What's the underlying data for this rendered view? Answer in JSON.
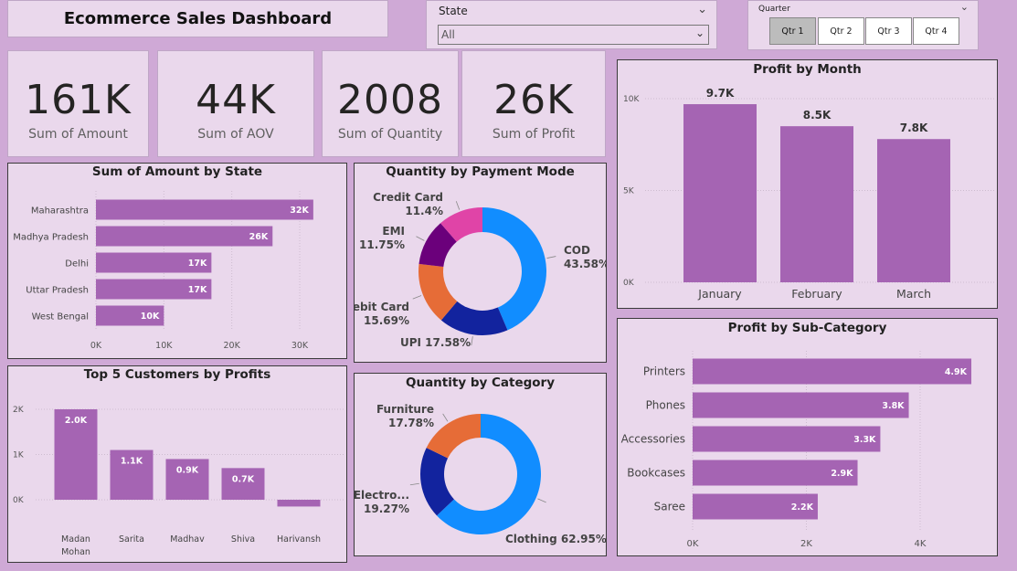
{
  "dashboard": {
    "title": "Ecommerce Sales Dashboard"
  },
  "state_slicer": {
    "label": "State",
    "value": "All"
  },
  "quarter_slicer": {
    "label": "Quarter",
    "options": [
      "Qtr 1",
      "Qtr 2",
      "Qtr 3",
      "Qtr 4"
    ],
    "selected": "Qtr 1"
  },
  "kpis": [
    {
      "value": "161K",
      "label": "Sum of Amount"
    },
    {
      "value": "44K",
      "label": "Sum of AOV"
    },
    {
      "value": "2008",
      "label": "Sum of Quantity"
    },
    {
      "value": "26K",
      "label": "Sum of Profit"
    }
  ],
  "colors": {
    "bar": "#a564b3",
    "bg": "#ead8ec",
    "page": "#cfa9d6"
  },
  "chart_data": [
    {
      "id": "amount_by_state",
      "type": "bar",
      "orientation": "horizontal",
      "title": "Sum of Amount by State",
      "categories": [
        "Maharashtra",
        "Madhya Pradesh",
        "Delhi",
        "Uttar Pradesh",
        "West Bengal"
      ],
      "values": [
        32,
        26,
        17,
        17,
        10
      ],
      "data_labels": [
        "32K",
        "26K",
        "17K",
        "17K",
        "10K"
      ],
      "xticks": [
        "0K",
        "10K",
        "20K",
        "30K"
      ],
      "xlim": [
        0,
        30
      ],
      "color": "#a564b3"
    },
    {
      "id": "payment_mode",
      "type": "pie",
      "title": "Quantity by Payment Mode",
      "slices": [
        {
          "name": "COD",
          "value": 43.58,
          "label": "43.58%",
          "color": "#118dff"
        },
        {
          "name": "UPI",
          "value": 17.58,
          "label": "17.58%",
          "color": "#12239e"
        },
        {
          "name": "Debit Card",
          "value": 15.69,
          "label": "15.69%",
          "color": "#e66c37"
        },
        {
          "name": "EMI",
          "value": 11.75,
          "label": "11.75%",
          "color": "#6b007b"
        },
        {
          "name": "Credit Card",
          "value": 11.4,
          "label": "11.4%",
          "color": "#e044a7"
        }
      ]
    },
    {
      "id": "profit_by_month",
      "type": "bar",
      "title": "Profit by Month",
      "categories": [
        "January",
        "February",
        "March"
      ],
      "values": [
        9.7,
        8.5,
        7.8
      ],
      "data_labels": [
        "9.7K",
        "8.5K",
        "7.8K"
      ],
      "yticks": [
        "0K",
        "5K",
        "10K"
      ],
      "ylim": [
        0,
        10
      ],
      "color": "#a564b3"
    },
    {
      "id": "top_customers",
      "type": "bar",
      "title": "Top 5 Customers by Profits",
      "categories": [
        "Madan Mohan",
        "Sarita",
        "Madhav",
        "Shiva",
        "Harivansh"
      ],
      "values": [
        2.0,
        1.1,
        0.9,
        0.7,
        -0.15
      ],
      "data_labels": [
        "2.0K",
        "1.1K",
        "0.9K",
        "0.7K",
        ""
      ],
      "yticks": [
        "0K",
        "1K",
        "2K"
      ],
      "ylim": [
        0,
        2
      ],
      "color": "#a564b3"
    },
    {
      "id": "category",
      "type": "pie",
      "title": "Quantity by Category",
      "slices": [
        {
          "name": "Clothing",
          "value": 62.95,
          "label": "62.95%",
          "color": "#118dff"
        },
        {
          "name": "Electro...",
          "value": 19.27,
          "label": "19.27%",
          "color": "#12239e"
        },
        {
          "name": "Furniture",
          "value": 17.78,
          "label": "17.78%",
          "color": "#e66c37"
        }
      ]
    },
    {
      "id": "profit_by_subcategory",
      "type": "bar",
      "orientation": "horizontal",
      "title": "Profit by Sub-Category",
      "categories": [
        "Printers",
        "Phones",
        "Accessories",
        "Bookcases",
        "Saree"
      ],
      "values": [
        4.9,
        3.8,
        3.3,
        2.9,
        2.2
      ],
      "data_labels": [
        "4.9K",
        "3.8K",
        "3.3K",
        "2.9K",
        "2.2K"
      ],
      "xticks": [
        "0K",
        "2K",
        "4K"
      ],
      "xlim": [
        0,
        4
      ],
      "color": "#a564b3"
    }
  ]
}
